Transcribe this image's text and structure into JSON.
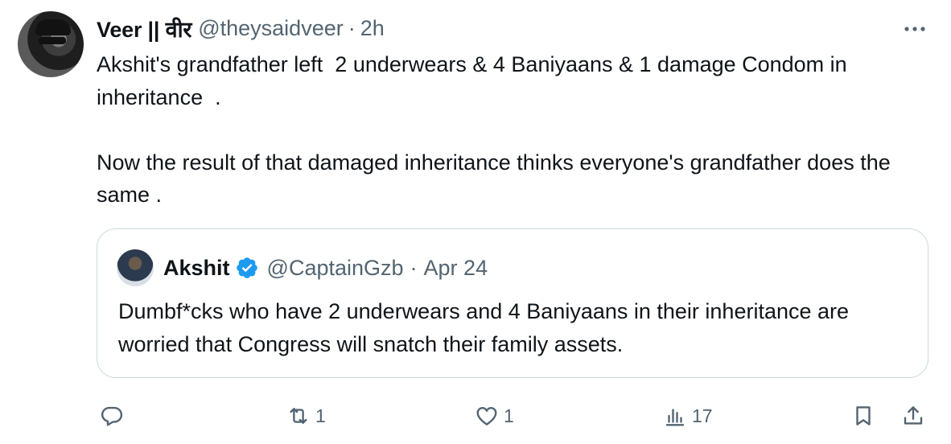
{
  "author": {
    "name": "Veer || वीर",
    "handle": "@theysaidveer",
    "separator": "·",
    "time": "2h",
    "avatar_icon": "profile-photo"
  },
  "tweet": {
    "text": "Akshit's grandfather left  2 underwears & 4 Baniyaans & 1 damage Condom in inheritance  .\n\nNow the result of that damaged inheritance thinks everyone's grandfather does the same ."
  },
  "quoted": {
    "name": "Akshit",
    "verified": true,
    "verified_color": "#1d9bf0",
    "handle": "@CaptainGzb",
    "separator": "·",
    "date": "Apr 24",
    "text": "Dumbf*cks who have 2 underwears and 4 Baniyaans in their inheritance are worried that Congress will snatch their family assets."
  },
  "actions": {
    "reply_count": "",
    "retweet_count": "1",
    "like_count": "1",
    "views_count": "17"
  },
  "colors": {
    "text": "#0f1419",
    "secondary": "#536471",
    "border": "#cfd9de"
  }
}
